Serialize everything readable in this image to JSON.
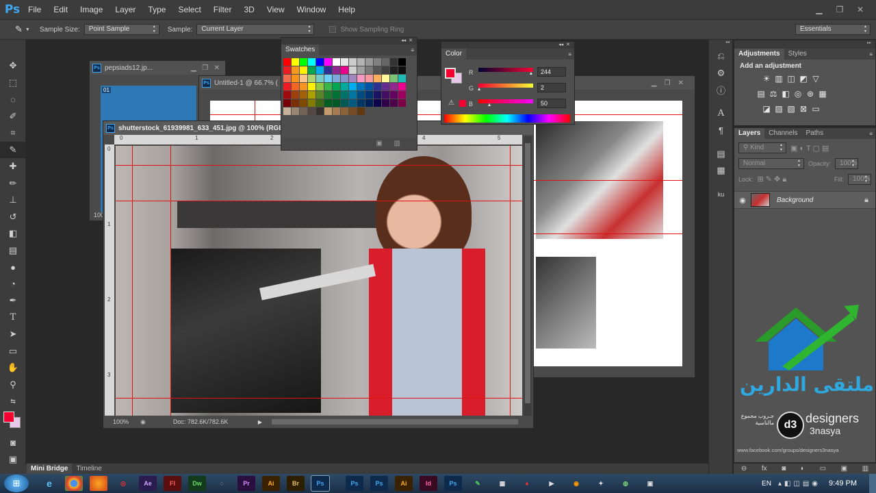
{
  "app": {
    "logo": "Ps"
  },
  "menu": [
    "File",
    "Edit",
    "Image",
    "Layer",
    "Type",
    "Select",
    "Filter",
    "3D",
    "View",
    "Window",
    "Help"
  ],
  "options": {
    "sample_size_label": "Sample Size:",
    "sample_size_value": "Point Sample",
    "sample_label": "Sample:",
    "sample_value": "Current Layer",
    "sampling_ring": "Show Sampling Ring",
    "workspace": "Essentials"
  },
  "docs": {
    "doc1_title": "pepsiads12.jp...",
    "doc1_layer_badge": "01",
    "doc1_zoom": "100",
    "doc2_title": "Untitled-1 @ 66.7% (",
    "main_title": "shutterstock_61939981_633_451.jpg @ 100% (RGB",
    "main_zoom": "100%",
    "main_doc_info": "Doc: 782.6K/782.6K",
    "ruler_top": [
      "0",
      "1",
      "2",
      "3",
      "4",
      "5"
    ],
    "ruler_left": [
      "0",
      "1",
      "2",
      "3"
    ]
  },
  "swatches": {
    "title": "Swatches",
    "colors_row1": [
      "#ff0000",
      "#ffff00",
      "#00ff00",
      "#00ffff",
      "#0000ff",
      "#ff00ff",
      "#ffffff",
      "#e6e6e6",
      "#cccccc",
      "#b3b3b3",
      "#999999",
      "#808080",
      "#666666",
      "#333333",
      "#000000"
    ],
    "colors_row2": [
      "#ee1d24",
      "#f5981f",
      "#fff100",
      "#00a651",
      "#00aeef",
      "#2e3192",
      "#92278f",
      "#ec008c",
      "#d0d0d0",
      "#a0a0a0",
      "#7a7a7a",
      "#555555",
      "#404040",
      "#202020",
      "#101010"
    ],
    "colors_row3": [
      "#f26c4f",
      "#f7941d",
      "#fdc689",
      "#acd373",
      "#7accc8",
      "#6dcff6",
      "#7da7d9",
      "#8393ca",
      "#a187be",
      "#f49ac2",
      "#f6989d",
      "#fbaf5d",
      "#fff799",
      "#7cc576",
      "#1cbbb4"
    ],
    "colors_row4": [
      "#ed1c24",
      "#f26522",
      "#f7941d",
      "#fff200",
      "#8dc63f",
      "#39b54a",
      "#00a651",
      "#00a99d",
      "#00aeef",
      "#0072bc",
      "#0054a6",
      "#2e3192",
      "#662d91",
      "#92278f",
      "#ec008c"
    ],
    "colors_row5": [
      "#9e0b0f",
      "#a0410d",
      "#a36209",
      "#aba000",
      "#598527",
      "#1a7b30",
      "#007236",
      "#00746b",
      "#0076a3",
      "#004b80",
      "#003471",
      "#1b1464",
      "#440e62",
      "#630460",
      "#9e005d"
    ],
    "colors_row6": [
      "#790000",
      "#7b2e00",
      "#7d4900",
      "#827b00",
      "#406618",
      "#005e20",
      "#005826",
      "#005952",
      "#005b7f",
      "#003663",
      "#002157",
      "#0d004c",
      "#32004b",
      "#4b0049",
      "#7b0046"
    ],
    "colors_row7": [
      "#c7b299",
      "#998675",
      "#736357",
      "#534741",
      "#37302d",
      "#c69c6d",
      "#a67c52",
      "#8c6239",
      "#754c24",
      "#603913"
    ]
  },
  "color_panel": {
    "title": "Color",
    "r_label": "R",
    "r_value": "244",
    "r_fraction": 0.957,
    "g_label": "G",
    "g_value": "2",
    "g_fraction": 0.008,
    "b_label": "B",
    "b_value": "50",
    "b_fraction": 0.196,
    "fg_color": "#f40232",
    "bg_color": "#e8c8e8"
  },
  "adjustments": {
    "tab_adjustments": "Adjustments",
    "tab_styles": "Styles",
    "add_label": "Add an adjustment"
  },
  "layers": {
    "tab_layers": "Layers",
    "tab_channels": "Channels",
    "tab_paths": "Paths",
    "kind": "Kind",
    "blend_mode": "Normal",
    "opacity_label": "Opacity:",
    "opacity_value": "100%",
    "lock_label": "Lock:",
    "fill_label": "Fill:",
    "fill_value": "100%",
    "layer_name": "Background"
  },
  "bottom_tabs": {
    "mini_bridge": "Mini Bridge",
    "timeline": "Timeline"
  },
  "watermark": {
    "arabic_name": "ملتقى الدارين",
    "brand": "designers",
    "brand2": "3nasya",
    "arabic_small": "جـروب مجموع مالناسية",
    "url": "www.facebook.com/groups/designers3nasya"
  },
  "taskbar": {
    "apps": [
      "Ae",
      "Fl",
      "Dw",
      "Pr",
      "Ai",
      "Br",
      "Ps",
      "Ps",
      "Ps",
      "Ai",
      "Id",
      "Ps"
    ],
    "lang": "EN",
    "time": "9:49 PM"
  },
  "colors": {
    "accent_blue": "#3fa8f5",
    "guide_red": "#e01010"
  }
}
